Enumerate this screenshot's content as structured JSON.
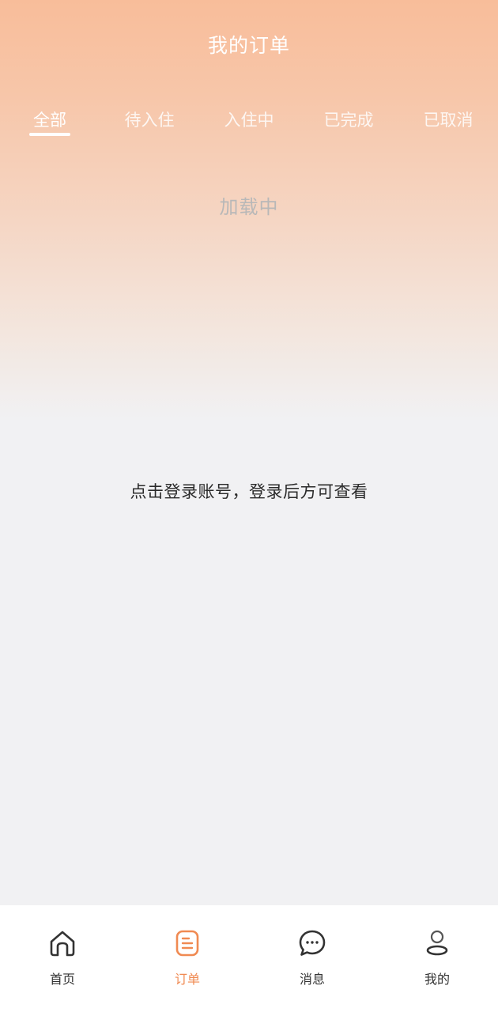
{
  "header": {
    "title": "我的订单"
  },
  "tabs": [
    {
      "label": "全部",
      "active": true
    },
    {
      "label": "待入住",
      "active": false
    },
    {
      "label": "入住中",
      "active": false
    },
    {
      "label": "已完成",
      "active": false
    },
    {
      "label": "已取消",
      "active": false
    }
  ],
  "status": {
    "loading_text": "加载中"
  },
  "empty_state": {
    "login_hint": "点击登录账号，登录后方可查看"
  },
  "bottom_nav": [
    {
      "label": "首页",
      "icon": "home-icon",
      "active": false
    },
    {
      "label": "订单",
      "icon": "order-icon",
      "active": true
    },
    {
      "label": "消息",
      "icon": "message-icon",
      "active": false
    },
    {
      "label": "我的",
      "icon": "profile-icon",
      "active": false
    }
  ],
  "colors": {
    "accent": "#f08a52",
    "header_gradient_top": "#f8bd9a",
    "background": "#f1f1f3"
  }
}
